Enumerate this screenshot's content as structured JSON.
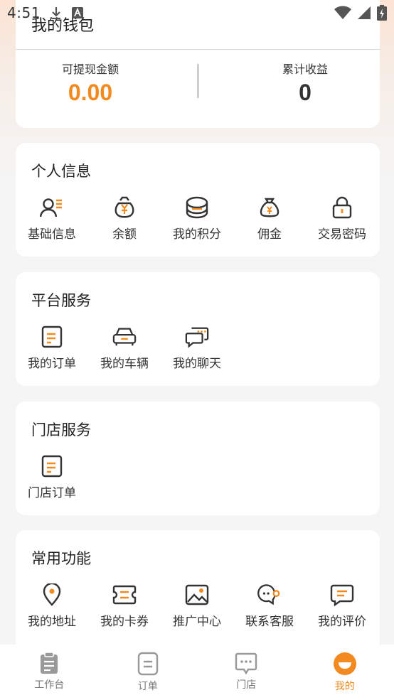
{
  "status_bar": {
    "time": "4:51"
  },
  "wallet": {
    "title": "我的钱包",
    "withdrawable_label": "可提现金额",
    "withdrawable_value": "0.00",
    "total_income_label": "累计收益",
    "total_income_value": "0"
  },
  "personal_info": {
    "title": "个人信息",
    "items": [
      {
        "label": "基础信息",
        "icon": "user-info-icon"
      },
      {
        "label": "余额",
        "icon": "money-bag-icon"
      },
      {
        "label": "我的积分",
        "icon": "coins-icon"
      },
      {
        "label": "佣金",
        "icon": "commission-bag-icon"
      },
      {
        "label": "交易密码",
        "icon": "lock-icon"
      }
    ]
  },
  "platform_services": {
    "title": "平台服务",
    "items": [
      {
        "label": "我的订单",
        "icon": "order-icon"
      },
      {
        "label": "我的车辆",
        "icon": "car-icon"
      },
      {
        "label": "我的聊天",
        "icon": "chat-icon"
      }
    ]
  },
  "store_services": {
    "title": "门店服务",
    "items": [
      {
        "label": "门店订单",
        "icon": "store-order-icon"
      }
    ]
  },
  "common_functions": {
    "title": "常用功能",
    "items": [
      {
        "label": "我的地址",
        "icon": "location-icon"
      },
      {
        "label": "我的卡券",
        "icon": "coupon-icon"
      },
      {
        "label": "推广中心",
        "icon": "image-icon"
      },
      {
        "label": "联系客服",
        "icon": "customer-service-icon"
      },
      {
        "label": "我的评价",
        "icon": "review-icon"
      }
    ]
  },
  "tabbar": {
    "tabs": [
      {
        "label": "工作台",
        "icon": "clipboard-icon",
        "active": false
      },
      {
        "label": "订单",
        "icon": "document-icon",
        "active": false
      },
      {
        "label": "门店",
        "icon": "message-icon",
        "active": false
      },
      {
        "label": "我的",
        "icon": "profile-icon",
        "active": true
      }
    ]
  },
  "colors": {
    "accent": "#f28a1f",
    "icon_dark": "#333333",
    "background": "#f5f5f5"
  }
}
